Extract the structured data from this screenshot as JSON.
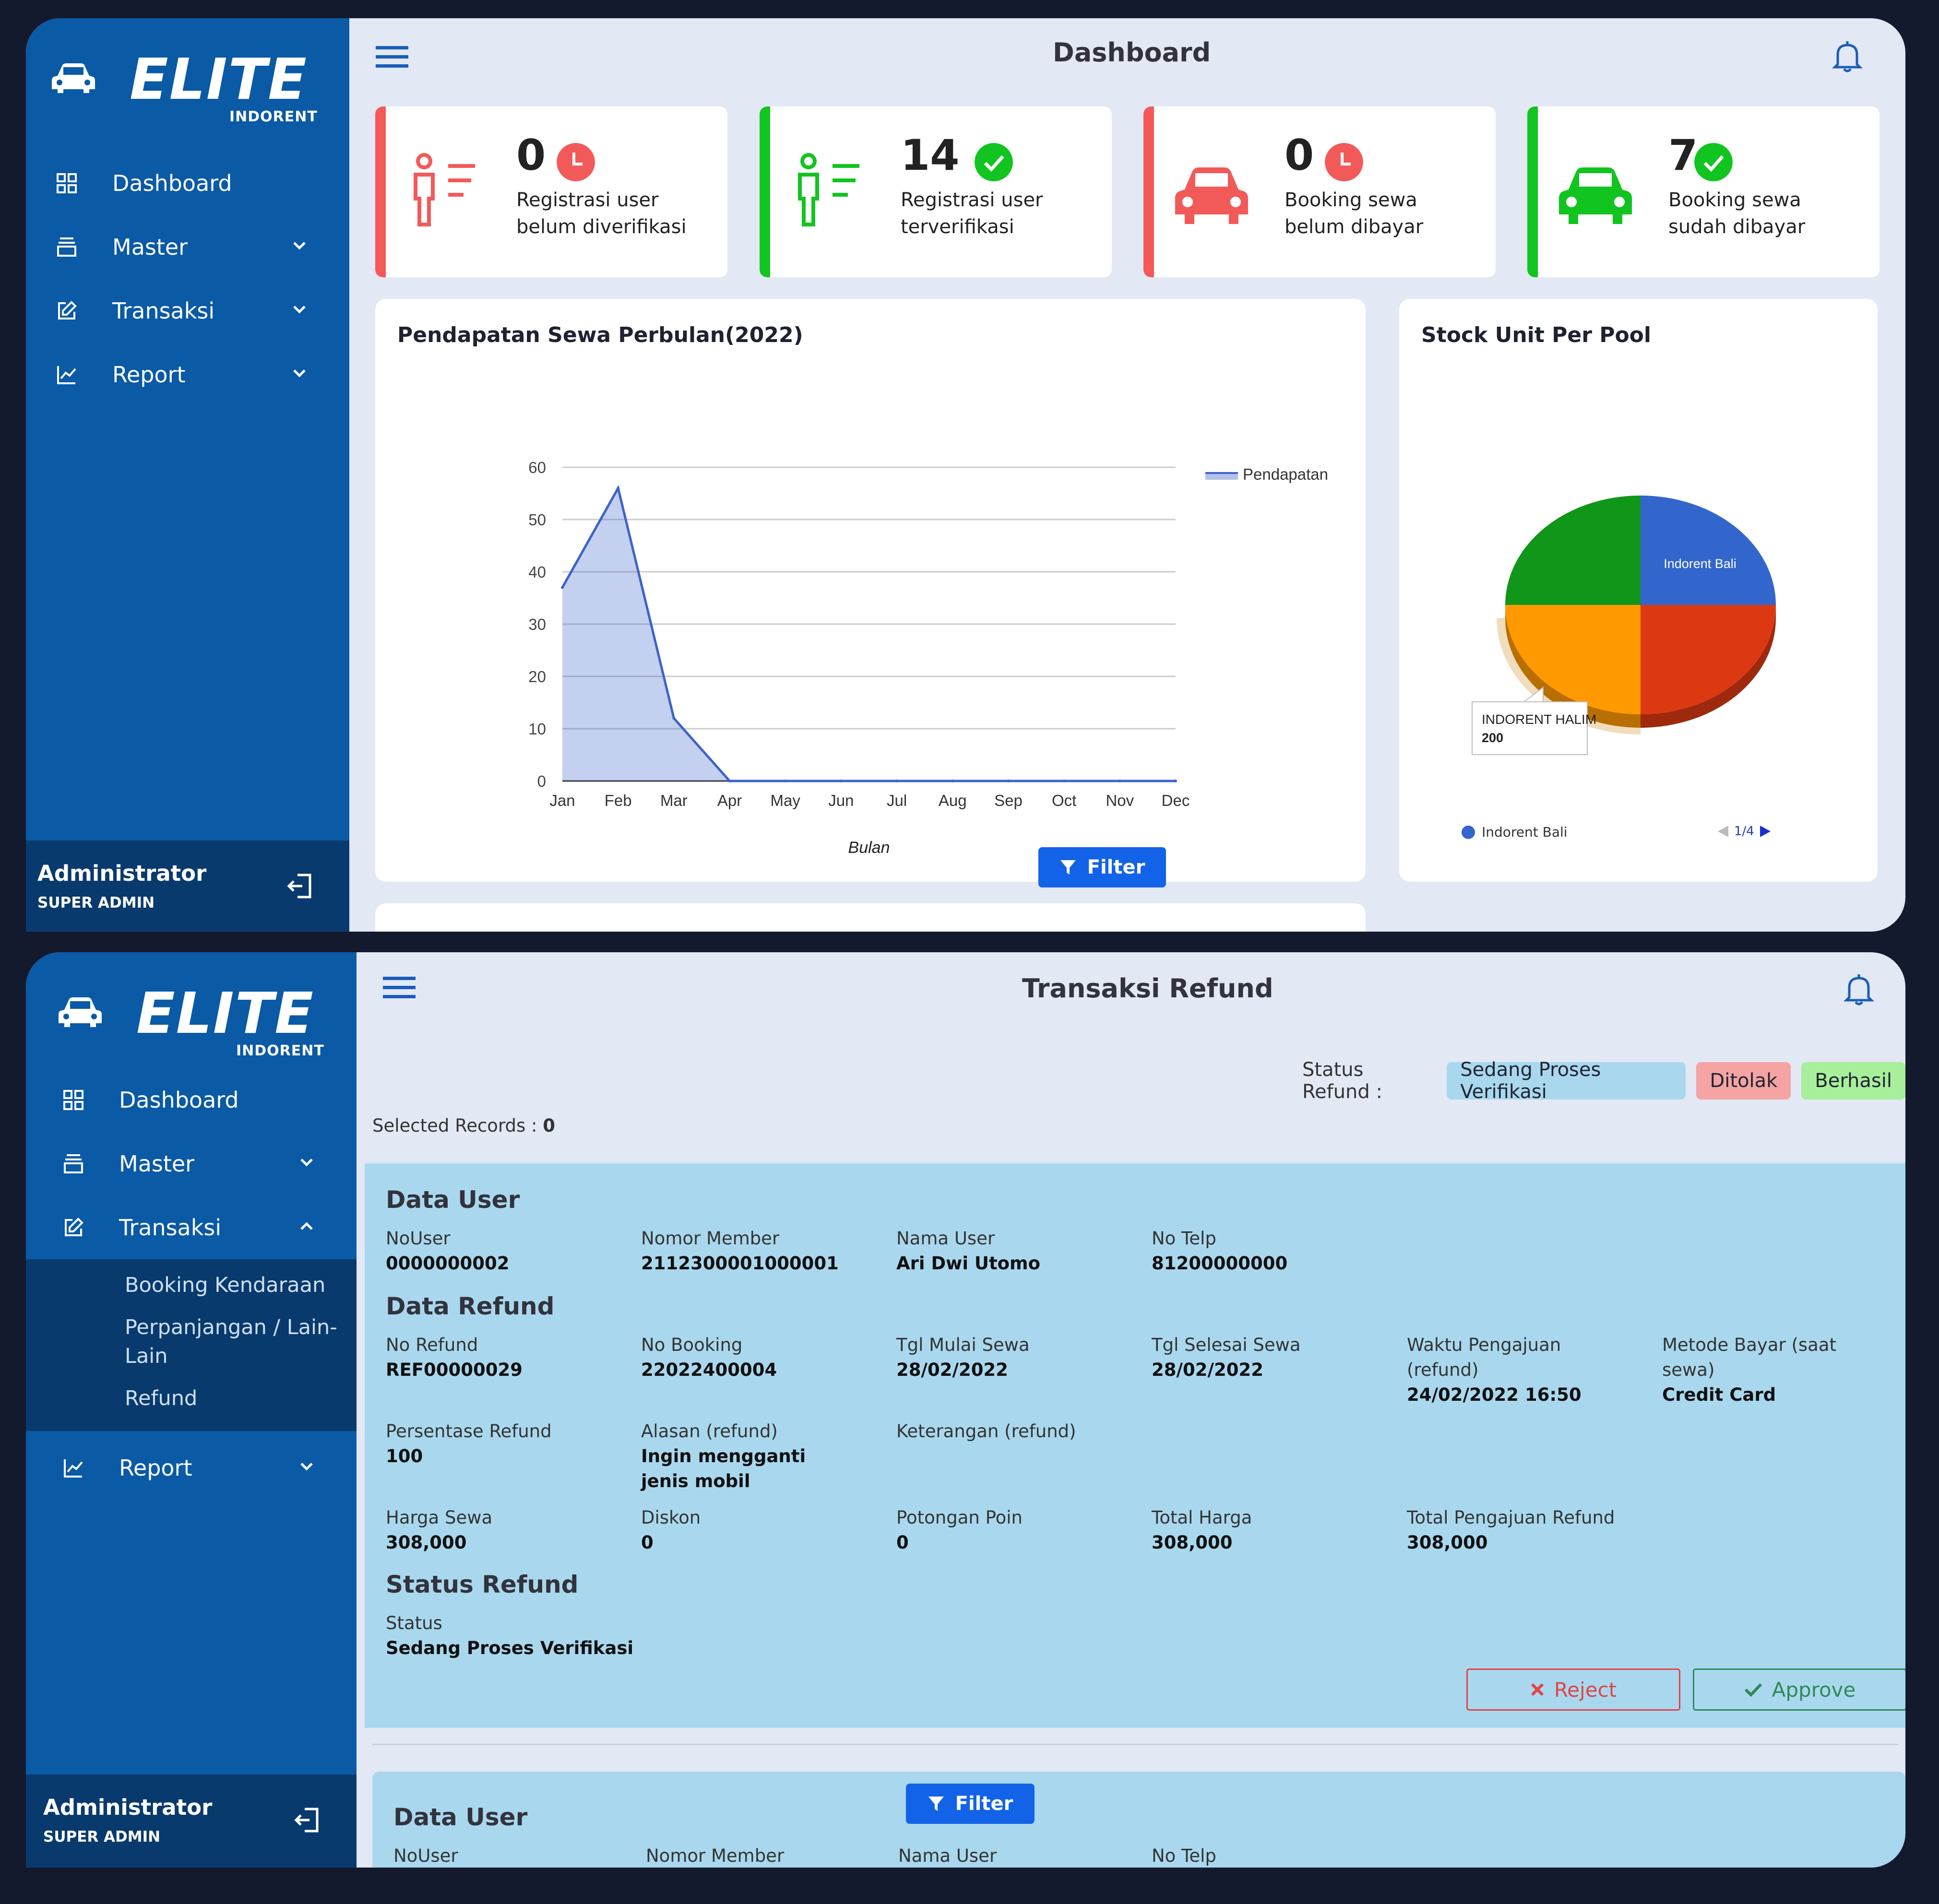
{
  "brand": {
    "logo": "ELITE",
    "logo_sub": "INDORENT"
  },
  "screen1": {
    "title": "Dashboard",
    "nav": [
      {
        "label": "Dashboard",
        "icon": "grid-icon"
      },
      {
        "label": "Master",
        "icon": "layers-icon"
      },
      {
        "label": "Transaksi",
        "icon": "edit-icon"
      },
      {
        "label": "Report",
        "icon": "chart-icon"
      }
    ],
    "user": {
      "name": "Administrator",
      "role": "SUPER ADMIN"
    },
    "stats": [
      {
        "value": "0",
        "line1": "Registrasi user",
        "line2": "belum diverifikasi",
        "color": "#f25a5a",
        "icon": "user-list-icon",
        "badge": "clock-icon"
      },
      {
        "value": "14",
        "line1": "Registrasi user",
        "line2": "terverifikasi",
        "color": "#12c41f",
        "icon": "user-list-icon",
        "badge": "check-icon"
      },
      {
        "value": "0",
        "line1": "Booking sewa",
        "line2": "belum dibayar",
        "color": "#f25a5a",
        "icon": "car-icon",
        "badge": "clock-icon"
      },
      {
        "value": "7",
        "line1": "Booking sewa",
        "line2": "sudah dibayar",
        "color": "#12c41f",
        "icon": "car-icon",
        "badge": "check-icon"
      }
    ],
    "line_chart": {
      "title": "Pendapatan Sewa Perbulan(2022)",
      "filter_label": "Filter",
      "chart_data": {
        "type": "area",
        "title": "Pendapatan Sewa Perbulan(2022)",
        "categories": [
          "Jan",
          "Feb",
          "Mar",
          "Apr",
          "May",
          "Jun",
          "Jul",
          "Aug",
          "Sep",
          "Oct",
          "Nov",
          "Dec"
        ],
        "series": [
          {
            "name": "Pendapatan",
            "values": [
              37,
              56,
              12,
              0,
              0,
              0,
              0,
              0,
              0,
              0,
              0,
              0
            ]
          }
        ],
        "xlabel": "Bulan",
        "ylabel": "",
        "ylim": [
          0,
          60
        ],
        "yticks": [
          "0",
          "10",
          "20",
          "30",
          "40",
          "50",
          "60"
        ],
        "grid": true,
        "legend": "top-right",
        "color": "#3d63c9"
      }
    },
    "pie_chart": {
      "title": "Stock Unit Per Pool",
      "legend_item": "Indorent Bali",
      "legend_pager": "1/4",
      "tooltip_name": "INDORENT HALIM",
      "tooltip_value": "200",
      "slice_label": "Indorent Bali",
      "chart_data": {
        "type": "pie",
        "title": "Stock Unit Per Pool",
        "slices": [
          {
            "name": "Indorent Bali",
            "value": 25,
            "color": "#3366cc"
          },
          {
            "name": "",
            "value": 25,
            "color": "#dc3912"
          },
          {
            "name": "INDORENT HALIM",
            "value": 200,
            "color": "#ff9900",
            "display_share": 25
          },
          {
            "name": "",
            "value": 25,
            "color": "#109618"
          }
        ],
        "legend": "bottom"
      }
    }
  },
  "screen2": {
    "title": "Transaksi Refund",
    "nav": [
      {
        "label": "Dashboard",
        "icon": "grid-icon"
      },
      {
        "label": "Master",
        "icon": "layers-icon"
      },
      {
        "label": "Transaksi",
        "icon": "edit-icon"
      },
      {
        "label": "Report",
        "icon": "chart-icon"
      }
    ],
    "subnav": [
      "Booking Kendaraan",
      "Perpanjangan / Lain-Lain",
      "Refund"
    ],
    "user": {
      "name": "Administrator",
      "role": "SUPER ADMIN"
    },
    "status_label": "Status Refund :",
    "status_pills": [
      {
        "label": "Sedang Proses Verifikasi",
        "bg": "#a9d8ee",
        "fg": "#1f2430"
      },
      {
        "label": "Ditolak",
        "bg": "#f5a3a3",
        "fg": "#1f2430"
      },
      {
        "label": "Berhasil",
        "bg": "#a8ef9c",
        "fg": "#1f2430"
      }
    ],
    "selected_label": "Selected Records :",
    "selected_count": "0",
    "record": {
      "data_user_title": "Data User",
      "data_user": [
        {
          "label": "NoUser",
          "value": "0000000002"
        },
        {
          "label": "Nomor Member",
          "value": "2112300001000001"
        },
        {
          "label": "Nama User",
          "value": "Ari Dwi Utomo"
        },
        {
          "label": "No Telp",
          "value": "81200000000"
        }
      ],
      "data_refund_title": "Data Refund",
      "data_refund_row1": [
        {
          "label": "No Refund",
          "value": "REF00000029"
        },
        {
          "label": "No Booking",
          "value": "22022400004"
        },
        {
          "label": "Tgl Mulai Sewa",
          "value": "28/02/2022"
        },
        {
          "label": "Tgl Selesai Sewa",
          "value": "28/02/2022"
        },
        {
          "label": "Waktu Pengajuan (refund)",
          "value": "24/02/2022 16:50"
        },
        {
          "label": "Metode Bayar (saat sewa)",
          "value": "Credit Card"
        }
      ],
      "data_refund_row2": [
        {
          "label": "Persentase Refund",
          "value": "100"
        },
        {
          "label": "Alasan (refund)",
          "value": "Ingin mengganti jenis mobil"
        },
        {
          "label": "Keterangan (refund)",
          "value": ""
        }
      ],
      "data_refund_row3": [
        {
          "label": "Harga Sewa",
          "value": "308,000"
        },
        {
          "label": "Diskon",
          "value": "0"
        },
        {
          "label": "Potongan Poin",
          "value": "0"
        },
        {
          "label": "Total Harga",
          "value": "308,000"
        },
        {
          "label": "Total Pengajuan Refund",
          "value": "308,000"
        }
      ],
      "status_title": "Status Refund",
      "status_label": "Status",
      "status_value": "Sedang Proses Verifikasi",
      "reject_label": "Reject",
      "approve_label": "Approve"
    },
    "record2": {
      "data_user_title": "Data User",
      "labels": [
        "NoUser",
        "Nomor Member",
        "Nama User",
        "No Telp"
      ]
    },
    "filter_label": "Filter"
  }
}
